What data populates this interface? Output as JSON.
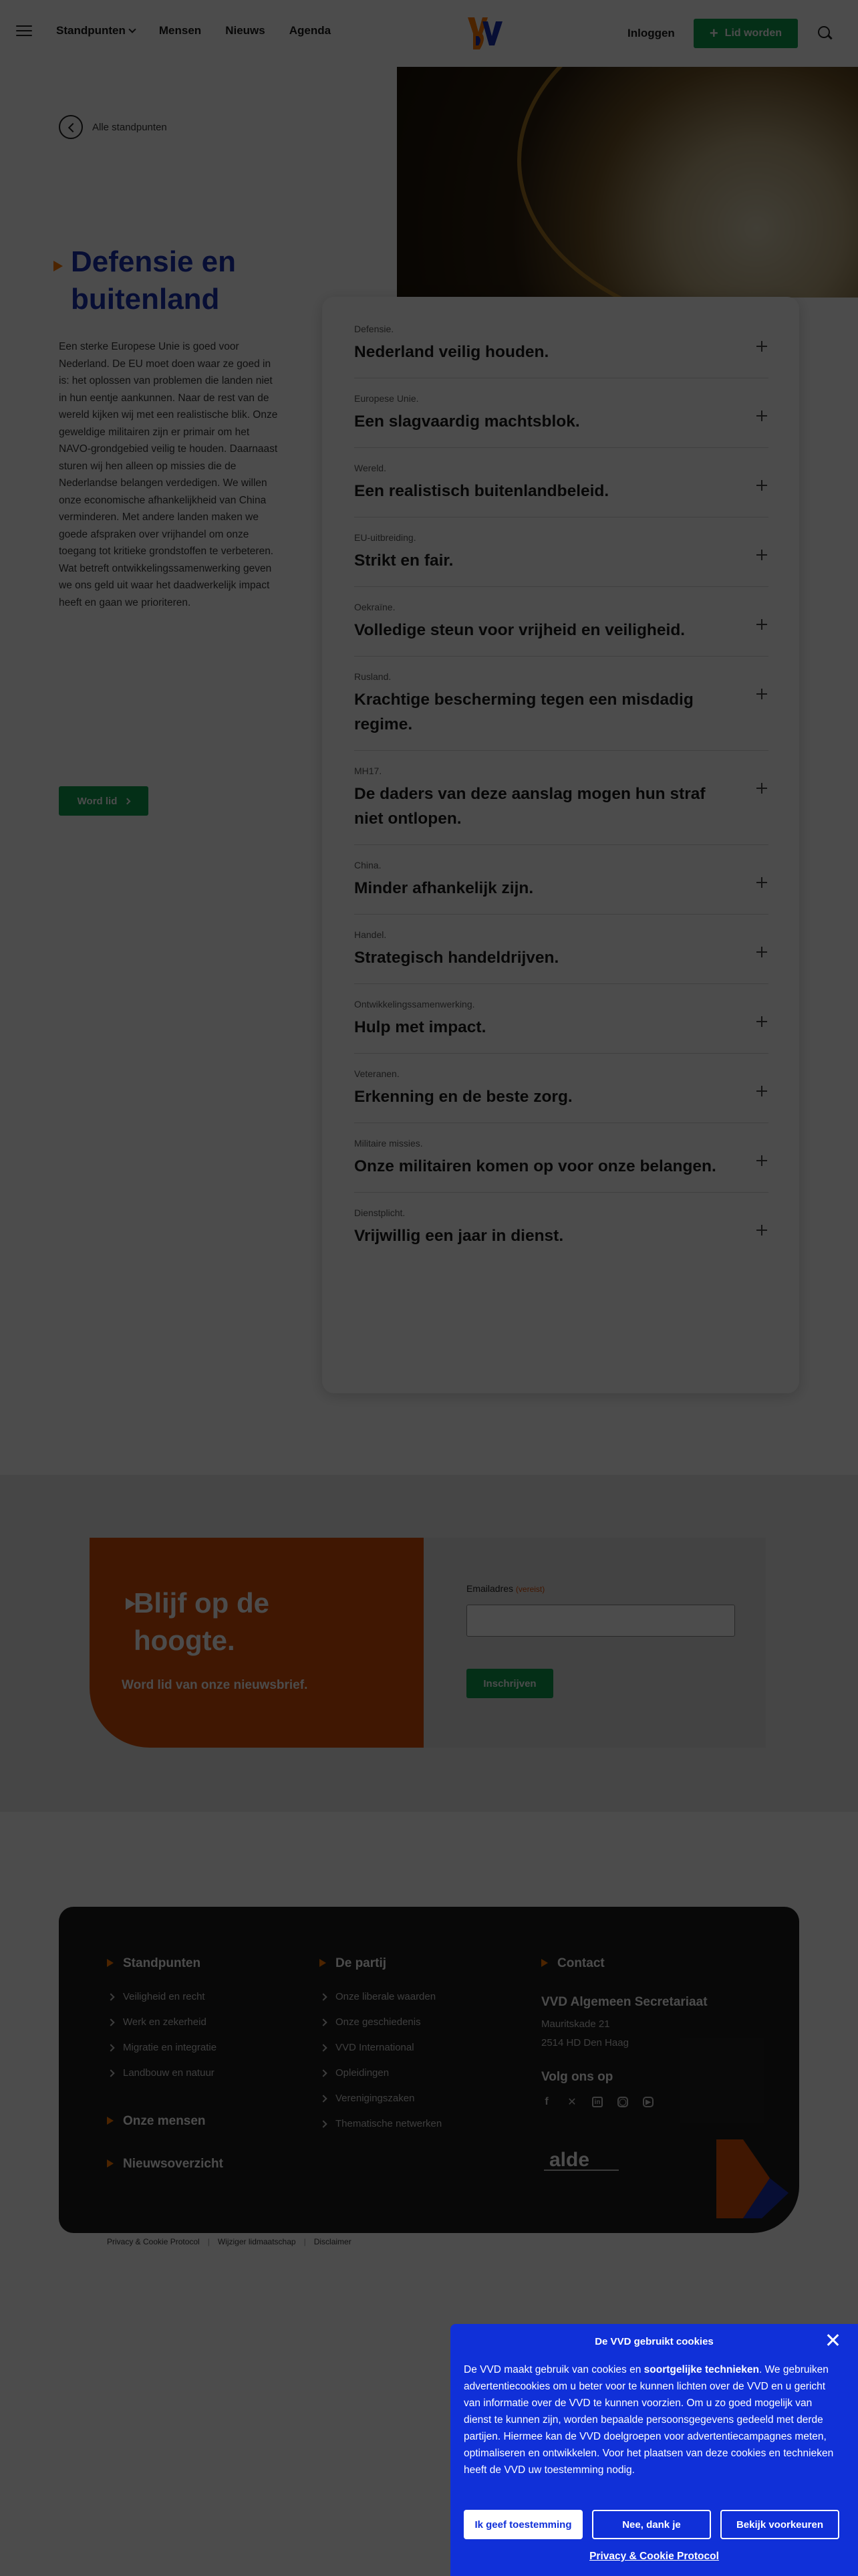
{
  "header": {
    "nav": [
      "Standpunten",
      "Mensen",
      "Nieuws",
      "Agenda"
    ],
    "login": "Inloggen",
    "join": "Lid worden"
  },
  "hero": {
    "back_link": "Alle standpunten",
    "title_line1": "Defensie en",
    "title_line2": "buitenland",
    "intro": "Een sterke Europese Unie is goed voor Nederland. De EU moet doen waar ze goed in is: het oplossen van problemen die landen niet in hun eentje aankunnen. Naar de rest van de wereld kijken wij met een realistische blik. Onze geweldige militairen zijn er primair om het NAVO-grondgebied veilig te houden. Daarnaast sturen wij hen alleen op missies die de Nederlandse belangen verdedigen. We willen onze economische afhankelijkheid van China verminderen. Met andere landen maken we goede afspraken over vrijhandel om onze toegang tot kritieke grondstoffen te verbeteren. Wat betreft ontwikkelingssamenwerking geven we ons geld uit waar het daadwerkelijk impact heeft en gaan we prioriteren.",
    "cta": "Word lid"
  },
  "positions": [
    {
      "kicker": "Defensie.",
      "title": "Nederland veilig houden."
    },
    {
      "kicker": "Europese Unie.",
      "title": "Een slagvaardig machtsblok."
    },
    {
      "kicker": "Wereld.",
      "title": "Een realistisch buitenlandbeleid."
    },
    {
      "kicker": "EU-uitbreiding.",
      "title": "Strikt en fair."
    },
    {
      "kicker": "Oekraïne.",
      "title": "Volledige steun voor vrijheid en veiligheid."
    },
    {
      "kicker": "Rusland.",
      "title": "Krachtige bescherming tegen een misdadig regime."
    },
    {
      "kicker": "MH17.",
      "title": "De daders van deze aanslag mogen hun straf niet ontlopen."
    },
    {
      "kicker": "China.",
      "title": "Minder afhankelijk zijn."
    },
    {
      "kicker": "Handel.",
      "title": "Strategisch handeldrijven."
    },
    {
      "kicker": "Ontwikkelingssamenwerking.",
      "title": "Hulp met impact."
    },
    {
      "kicker": "Veteranen.",
      "title": "Erkenning en de beste zorg."
    },
    {
      "kicker": "Militaire missies.",
      "title": "Onze militairen komen op voor onze belangen."
    },
    {
      "kicker": "Dienstplicht.",
      "title": "Vrijwillig een jaar in dienst."
    }
  ],
  "newsletter": {
    "title_line1": "Blijf op de",
    "title_line2": "hoogte.",
    "subtitle": "Word lid van onze nieuwsbrief.",
    "email_label": "Emailadres",
    "required": "(vereist)",
    "submit": "Inschrijven"
  },
  "footer": {
    "col1": {
      "heading": "Standpunten",
      "links": [
        "Veiligheid en recht",
        "Werk en zekerheid",
        "Migratie en integratie",
        "Landbouw en natuur"
      ],
      "section2": "Onze mensen",
      "section3": "Nieuwsoverzicht"
    },
    "col2": {
      "heading": "De partij",
      "links": [
        "Onze liberale waarden",
        "Onze geschiedenis",
        "VVD International",
        "Opleidingen",
        "Verenigingszaken",
        "Thematische netwerken"
      ]
    },
    "col3": {
      "heading": "Contact",
      "org": "VVD Algemeen Secretariaat",
      "address1": "Mauritskade 21",
      "address2": "2514 HD Den Haag",
      "follow": "Volg ons op",
      "socials": [
        "facebook-icon",
        "x-icon",
        "linkedin-icon",
        "instagram-icon",
        "youtube-icon"
      ]
    },
    "alde": "alde",
    "legal": [
      "Privacy & Cookie Protocol",
      "Wijziger lidmaatschap",
      "Disclaimer"
    ]
  },
  "cookie": {
    "title": "De VVD gebruikt cookies",
    "text_before": "De VVD maakt gebruik van cookies en ",
    "text_bold": "soortgelijke technieken",
    "text_after": ". We gebruiken advertentiecookies om u beter voor te kunnen lichten over de VVD en u gericht van informatie over de VVD te kunnen voorzien. Om u zo goed mogelijk van dienst te kunnen zijn, worden bepaalde persoonsgegevens gedeeld met derde partijen. Hiermee kan de VVD doelgroepen voor advertentiecampagnes meten, optimaliseren en ontwikkelen. Voor het plaatsen van deze cookies en technieken heeft de VVD uw toestemming nodig.",
    "accept": "Ik geef toestemming",
    "decline": "Nee, dank je",
    "prefs": "Bekijk voorkeuren",
    "policy": "Privacy & Cookie Protocol"
  },
  "colors": {
    "brand_blue": "#1a2fb0",
    "cookie_blue": "#1030d8",
    "orange": "#ff7a00",
    "green": "#0f9d4f",
    "newsletter_orange": "#d84e08"
  }
}
